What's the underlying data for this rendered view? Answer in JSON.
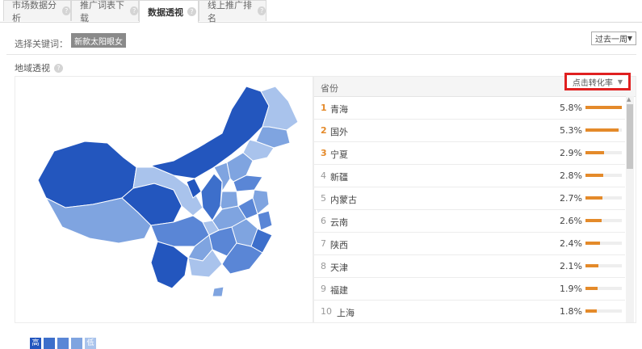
{
  "tabs": [
    {
      "label": "市场数据分析",
      "active": false
    },
    {
      "label": "推广词表下载",
      "active": false
    },
    {
      "label": "数据透视",
      "active": true
    },
    {
      "label": "线上推广排名",
      "active": false
    }
  ],
  "filter": {
    "keyword_label": "选择关键词：",
    "keyword_value": "新款太阳眼女",
    "period": "过去一周"
  },
  "region": {
    "title": "地域透视"
  },
  "legend": {
    "high": "高",
    "low": "低",
    "colors": [
      "#2356be",
      "#3d6fcb",
      "#5a86d6",
      "#7fa4e0",
      "#a9c3ec"
    ]
  },
  "table": {
    "header_province": "省份",
    "sort_label": "点击转化率",
    "rows": [
      {
        "rank": "1",
        "name": "青海",
        "pct": "5.8%",
        "value": 5.8
      },
      {
        "rank": "2",
        "name": "国外",
        "pct": "5.3%",
        "value": 5.3
      },
      {
        "rank": "3",
        "name": "宁夏",
        "pct": "2.9%",
        "value": 2.9
      },
      {
        "rank": "4",
        "name": "新疆",
        "pct": "2.8%",
        "value": 2.8
      },
      {
        "rank": "5",
        "name": "内蒙古",
        "pct": "2.7%",
        "value": 2.7
      },
      {
        "rank": "6",
        "name": "云南",
        "pct": "2.6%",
        "value": 2.6
      },
      {
        "rank": "7",
        "name": "陕西",
        "pct": "2.4%",
        "value": 2.4
      },
      {
        "rank": "8",
        "name": "天津",
        "pct": "2.1%",
        "value": 2.1
      },
      {
        "rank": "9",
        "name": "福建",
        "pct": "1.9%",
        "value": 1.9
      },
      {
        "rank": "10",
        "name": "上海",
        "pct": "1.8%",
        "value": 1.8
      }
    ]
  }
}
